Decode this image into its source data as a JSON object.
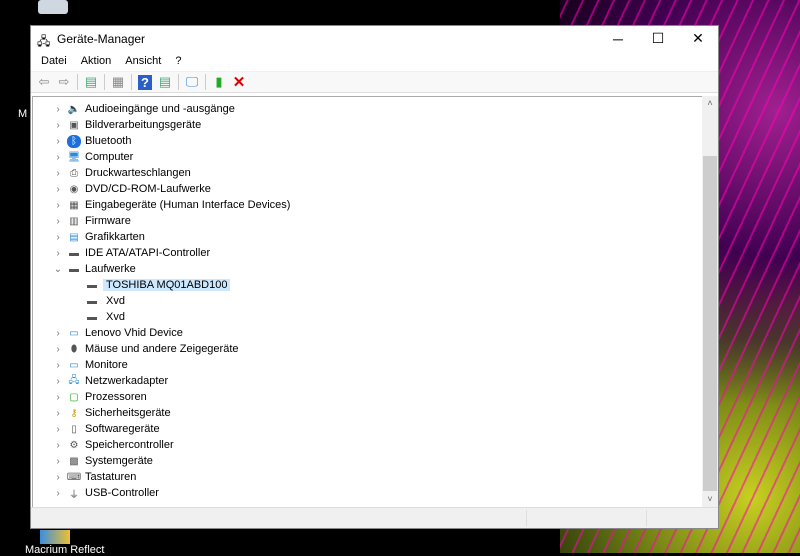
{
  "desktop": {
    "icons": [
      {
        "label": "Macrium Reflect"
      }
    ]
  },
  "window": {
    "title": "Geräte-Manager"
  },
  "menu": [
    "Datei",
    "Aktion",
    "Ansicht",
    "?"
  ],
  "toolbar": [
    "back",
    "forward",
    "properties",
    "update-driver",
    "help",
    "view",
    "scan",
    "add-legacy",
    "uninstall"
  ],
  "tree": [
    {
      "label": "Audioeingänge und -ausgänge",
      "icon": "speaker-icon",
      "expanded": false
    },
    {
      "label": "Bildverarbeitungsgeräte",
      "icon": "camera-icon",
      "expanded": false
    },
    {
      "label": "Bluetooth",
      "icon": "bluetooth-icon",
      "expanded": false
    },
    {
      "label": "Computer",
      "icon": "computer-icon",
      "expanded": false
    },
    {
      "label": "Druckwarteschlangen",
      "icon": "printer-icon",
      "expanded": false
    },
    {
      "label": "DVD/CD-ROM-Laufwerke",
      "icon": "disc-icon",
      "expanded": false
    },
    {
      "label": "Eingabegeräte (Human Interface Devices)",
      "icon": "hid-icon",
      "expanded": false
    },
    {
      "label": "Firmware",
      "icon": "chip-icon",
      "expanded": false
    },
    {
      "label": "Grafikkarten",
      "icon": "display-adapter-icon",
      "expanded": false
    },
    {
      "label": "IDE ATA/ATAPI-Controller",
      "icon": "controller-icon",
      "expanded": false
    },
    {
      "label": "Laufwerke",
      "icon": "drive-icon",
      "expanded": true,
      "children": [
        {
          "label": "TOSHIBA MQ01ABD100",
          "selected": true
        },
        {
          "label": "Xvd"
        },
        {
          "label": "Xvd"
        }
      ]
    },
    {
      "label": "Lenovo Vhid Device",
      "icon": "monitor-icon",
      "expanded": false
    },
    {
      "label": "Mäuse und andere Zeigegeräte",
      "icon": "mouse-icon",
      "expanded": false
    },
    {
      "label": "Monitore",
      "icon": "monitor-icon",
      "expanded": false
    },
    {
      "label": "Netzwerkadapter",
      "icon": "network-icon",
      "expanded": false
    },
    {
      "label": "Prozessoren",
      "icon": "cpu-icon",
      "expanded": false
    },
    {
      "label": "Sicherheitsgeräte",
      "icon": "key-icon",
      "expanded": false
    },
    {
      "label": "Softwaregeräte",
      "icon": "software-device-icon",
      "expanded": false
    },
    {
      "label": "Speichercontroller",
      "icon": "storage-controller-icon",
      "expanded": false
    },
    {
      "label": "Systemgeräte",
      "icon": "system-icon",
      "expanded": false
    },
    {
      "label": "Tastaturen",
      "icon": "keyboard-icon",
      "expanded": false
    },
    {
      "label": "USB-Controller",
      "icon": "usb-icon",
      "expanded": false
    }
  ]
}
